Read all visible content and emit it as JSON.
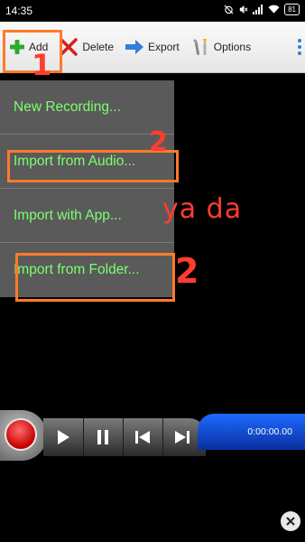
{
  "status": {
    "time": "14:35",
    "battery": "81"
  },
  "toolbar": {
    "add_label": "Add",
    "delete_label": "Delete",
    "export_label": "Export",
    "options_label": "Options"
  },
  "menu": {
    "items": [
      {
        "label": "New Recording..."
      },
      {
        "label": "Import from Audio..."
      },
      {
        "label": "Import with App..."
      },
      {
        "label": "Import from Folder..."
      }
    ]
  },
  "annotations": {
    "step1": "1",
    "step2a": "2",
    "step2b": "2",
    "note": "ya da",
    "color": "#ff3d2e",
    "box_color": "#ff7a2a"
  },
  "player": {
    "time": "0:00:00.00"
  },
  "colors": {
    "menu_text": "#7dff6f",
    "menu_bg": "#5a5a5a",
    "time_panel": "#1e6bff"
  }
}
